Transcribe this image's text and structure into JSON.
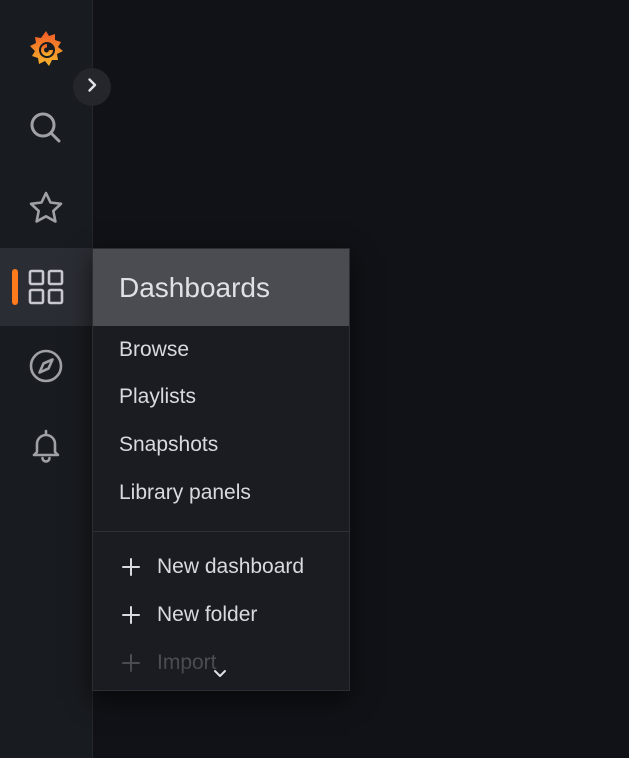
{
  "sidebar": {
    "logo": "grafana-logo-icon",
    "items": [
      {
        "icon": "search-icon"
      },
      {
        "icon": "star-icon"
      },
      {
        "icon": "dashboards-grid-icon",
        "active": true
      },
      {
        "icon": "compass-icon"
      },
      {
        "icon": "bell-icon"
      }
    ],
    "expand_icon": "chevron-right-icon"
  },
  "menu": {
    "title": "Dashboards",
    "items": [
      {
        "label": "Browse"
      },
      {
        "label": "Playlists"
      },
      {
        "label": "Snapshots"
      },
      {
        "label": "Library panels"
      }
    ],
    "actions": [
      {
        "label": "New dashboard",
        "icon": "plus-icon"
      },
      {
        "label": "New folder",
        "icon": "plus-icon"
      },
      {
        "label": "Import",
        "icon": "plus-icon"
      }
    ],
    "scroll_icon": "chevron-down-icon"
  },
  "colors": {
    "accent": "#ff7a1a",
    "background": "#111217",
    "sidebar": "#181b1f",
    "menu_header": "#4a4c52"
  }
}
